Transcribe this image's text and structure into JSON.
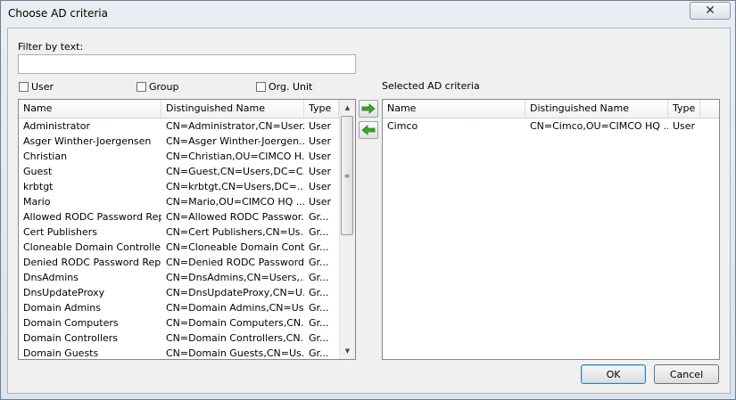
{
  "window": {
    "title": "Choose AD criteria"
  },
  "filter": {
    "label": "Filter by text:",
    "value": ""
  },
  "checkboxes": [
    {
      "label": "User",
      "checked": false
    },
    {
      "label": "Group",
      "checked": false
    },
    {
      "label": "Org. Unit",
      "checked": false
    }
  ],
  "left_list": {
    "columns": [
      "Name",
      "Distinguished Name",
      "Type"
    ],
    "rows": [
      [
        "Administrator",
        "CN=Administrator,CN=User...",
        "User"
      ],
      [
        "Asger Winther-Joergensen",
        "CN=Asger Winther-Joergen...",
        "User"
      ],
      [
        "Christian",
        "CN=Christian,OU=CIMCO H...",
        "User"
      ],
      [
        "Guest",
        "CN=Guest,CN=Users,DC=C...",
        "User"
      ],
      [
        "krbtgt",
        "CN=krbtgt,CN=Users,DC=...",
        "User"
      ],
      [
        "Mario",
        "CN=Mario,OU=CIMCO HQ ...",
        "User"
      ],
      [
        "Allowed RODC Password Rep...",
        "CN=Allowed RODC Passwor...",
        "Gr..."
      ],
      [
        "Cert Publishers",
        "CN=Cert Publishers,CN=Us...",
        "Gr..."
      ],
      [
        "Cloneable Domain Controllers",
        "CN=Cloneable Domain Cont...",
        "Gr..."
      ],
      [
        "Denied RODC Password Repli...",
        "CN=Denied RODC Password...",
        "Gr..."
      ],
      [
        "DnsAdmins",
        "CN=DnsAdmins,CN=Users,...",
        "Gr..."
      ],
      [
        "DnsUpdateProxy",
        "CN=DnsUpdateProxy,CN=U...",
        "Gr..."
      ],
      [
        "Domain Admins",
        "CN=Domain Admins,CN=Us...",
        "Gr..."
      ],
      [
        "Domain Computers",
        "CN=Domain Computers,CN...",
        "Gr..."
      ],
      [
        "Domain Controllers",
        "CN=Domain Controllers,CN...",
        "Gr..."
      ],
      [
        "Domain Guests",
        "CN=Domain Guests,CN=Us...",
        "Gr..."
      ]
    ]
  },
  "selected": {
    "label": "Selected AD criteria",
    "columns": [
      "Name",
      "Distinguished Name",
      "Type"
    ],
    "rows": [
      [
        "Cimco",
        "CN=Cimco,OU=CIMCO HQ ...",
        "User"
      ]
    ]
  },
  "buttons": {
    "ok": "OK",
    "cancel": "Cancel"
  },
  "icons": {
    "close": "close-icon",
    "add": "arrow-right-icon",
    "remove": "arrow-left-icon"
  },
  "colors": {
    "arrow_green": "#3aa52f"
  }
}
